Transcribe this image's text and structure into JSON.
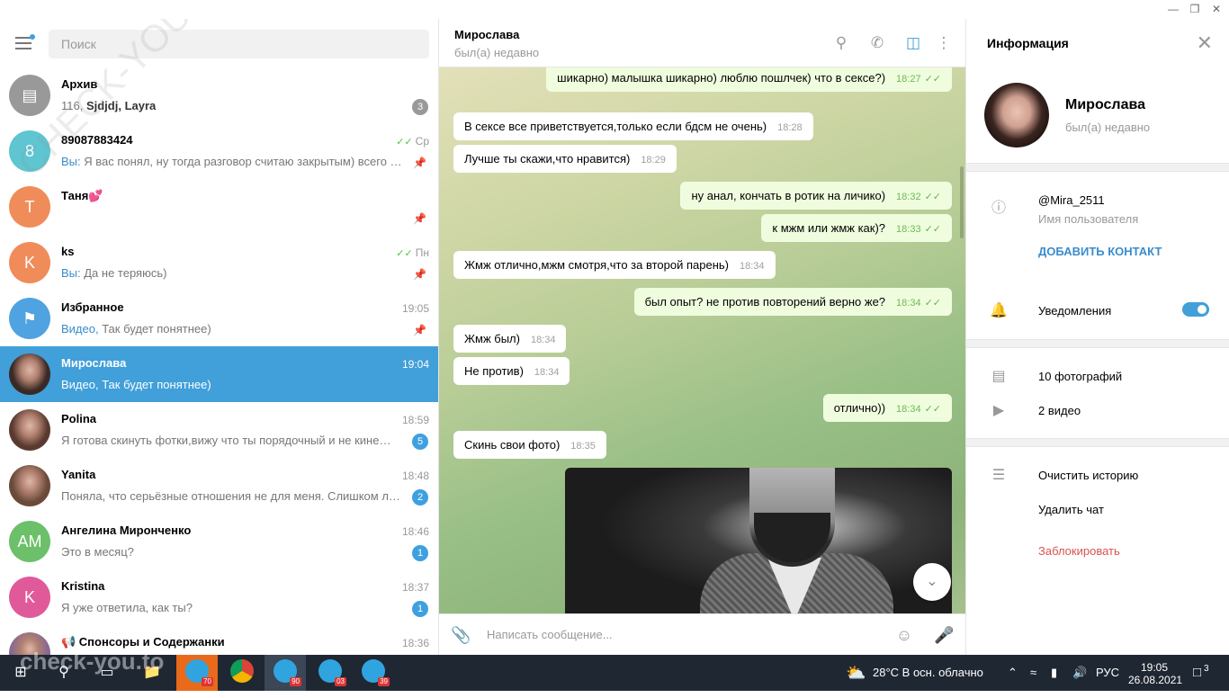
{
  "window": {
    "minimize": "—",
    "maximize": "❐",
    "close": "✕"
  },
  "search": {
    "placeholder": "Поиск"
  },
  "chats": [
    {
      "name": "Архив",
      "time": "",
      "preview_prefix": "116, ",
      "preview_bold": "Sjdjdj, Layra",
      "preview": "",
      "badge": "3",
      "badge_gray": true,
      "avatar": "archive-icon",
      "avatar_color": "#999999"
    },
    {
      "name": "89087883424",
      "time": "Ср",
      "you": "Вы: ",
      "preview": "Я вас понял, ну тогда разговор считаю закрытым) всего …",
      "avatar_letter": "8",
      "avatar_color": "#5ec5d1",
      "pinned": true,
      "read": true
    },
    {
      "name": "Таня💕",
      "time": "",
      "preview": "",
      "avatar_letter": "Т",
      "avatar_color": "#f08c5a",
      "pinned": true
    },
    {
      "name": "ks",
      "time": "Пн",
      "you": "Вы: ",
      "preview": "Да не теряюсь)",
      "avatar_letter": "K",
      "avatar_color": "#f08c5a",
      "pinned": true,
      "read": true
    },
    {
      "name": "Избранное",
      "time": "19:05",
      "you": "Видео, ",
      "preview": "Так будет понятнее)",
      "avatar": "bookmark-icon",
      "avatar_color": "#4fa3e0",
      "pinned": true
    },
    {
      "name": "Мирослава",
      "time": "19:04",
      "preview": "Видео, Так будет понятнее)",
      "avatar_color": "#3a2a25",
      "active": true
    },
    {
      "name": "Polina",
      "time": "18:59",
      "preview": "Я готова скинуть фотки,вижу что ты порядочный и не кине…",
      "badge": "5",
      "avatar_color": "#5a3a30"
    },
    {
      "name": "Yanita",
      "time": "18:48",
      "preview": "Поняла, что серьёзные отношения не для меня. Слишком л…",
      "badge": "2",
      "avatar_color": "#6a4a3a"
    },
    {
      "name": "Ангелина Миронченко",
      "time": "18:46",
      "preview": "Это в месяц?",
      "badge": "1",
      "avatar_letter": "AM",
      "avatar_color": "#6cc06a"
    },
    {
      "name": "Kristina",
      "time": "18:37",
      "preview": "Я уже ответила, как ты?",
      "badge": "1",
      "avatar_letter": "K",
      "avatar_color": "#e05a9a"
    },
    {
      "name": "📢 Спонсоры и Содержанки",
      "time": "18:36",
      "preview": "",
      "avatar_color": "#8a6a90"
    }
  ],
  "header": {
    "name": "Мирослава",
    "status": "был(а) недавно"
  },
  "messages": [
    {
      "text": "шикарно) малышка шикарно) люблю пошлчек) что в сексе?)",
      "time": "18:27",
      "out": true
    },
    {
      "text": "В сексе все приветствуется,только если бдсм не очень)",
      "time": "18:28",
      "out": false
    },
    {
      "text": "Лучше ты скажи,что нравится)",
      "time": "18:29",
      "out": false
    },
    {
      "text": "ну анал, кончать в ротик на личико)",
      "time": "18:32",
      "out": true
    },
    {
      "text": "к мжм или жмж как)?",
      "time": "18:33",
      "out": true
    },
    {
      "text": "Жмж отлично,мжм смотря,что за второй парень)",
      "time": "18:34",
      "out": false
    },
    {
      "text": "был опыт? не против повторений верно же?",
      "time": "18:34",
      "out": true
    },
    {
      "text": "Жмж был)",
      "time": "18:34",
      "out": false
    },
    {
      "text": "Не против)",
      "time": "18:34",
      "out": false
    },
    {
      "text": "отлично))",
      "time": "18:34",
      "out": true
    },
    {
      "text": "Скинь свои фото)",
      "time": "18:35",
      "out": false
    }
  ],
  "compose": {
    "placeholder": "Написать сообщение..."
  },
  "info": {
    "title": "Информация",
    "name": "Мирослава",
    "status": "был(а) недавно",
    "username": "@Mira_2511",
    "username_label": "Имя пользователя",
    "add_contact": "ДОБАВИТЬ КОНТАКТ",
    "notifications": "Уведомления",
    "notifications_on": true,
    "photos": "10 фотографий",
    "videos": "2 видео",
    "clear_history": "Очистить историю",
    "delete_chat": "Удалить чат",
    "block": "Заблокировать",
    "accent": "#419fd9",
    "danger": "#d9534f"
  },
  "taskbar": {
    "badges": [
      "70",
      "90",
      "03",
      "39"
    ],
    "weather": "28°C  В осн. облачно",
    "lang": "РУС",
    "time": "19:05",
    "date": "26.08.2021",
    "notif_count": "3"
  },
  "watermarks": {
    "overlay": "check-you.to",
    "diagonal": "CHECK-YOU.ME"
  }
}
